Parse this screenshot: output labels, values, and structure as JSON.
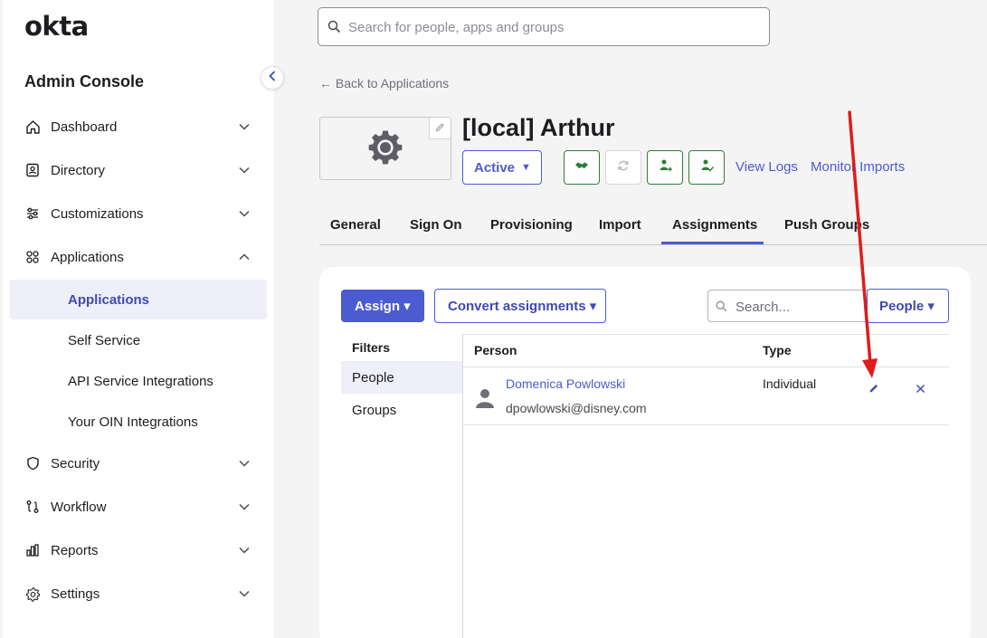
{
  "sidebar": {
    "logo": "okta",
    "title": "Admin Console",
    "items": [
      {
        "label": "Dashboard",
        "icon": "home-icon"
      },
      {
        "label": "Directory",
        "icon": "directory-icon"
      },
      {
        "label": "Customizations",
        "icon": "sliders-icon"
      },
      {
        "label": "Applications",
        "icon": "grid-icon"
      },
      {
        "label": "Security",
        "icon": "shield-icon"
      },
      {
        "label": "Workflow",
        "icon": "workflow-icon"
      },
      {
        "label": "Reports",
        "icon": "bar-chart-icon"
      },
      {
        "label": "Settings",
        "icon": "gear-icon"
      }
    ],
    "sub_items": [
      {
        "label": "Applications",
        "active": true
      },
      {
        "label": "Self Service"
      },
      {
        "label": "API Service Integrations"
      },
      {
        "label": "Your OIN Integrations"
      }
    ]
  },
  "search": {
    "placeholder": "Search for people, apps and groups"
  },
  "header": {
    "back_link": "← Back to Applications",
    "app_title": "[local] Arthur",
    "status": "Active",
    "view_logs": "View Logs",
    "monitor_imports": "Monitor Imports"
  },
  "tabs": [
    "General",
    "Sign On",
    "Provisioning",
    "Import",
    "Assignments",
    "Push Groups"
  ],
  "active_tab": "Assignments",
  "toolbar": {
    "assign": "Assign ▾",
    "convert": "Convert assignments ▾",
    "search_placeholder": "Search...",
    "people_dd": "People ▾"
  },
  "filters": {
    "label": "Filters",
    "items": [
      "People",
      "Groups"
    ]
  },
  "table": {
    "headers": [
      "Person",
      "Type"
    ],
    "rows": [
      {
        "name": "Domenica Powlowski",
        "email": "dpowlowski@disney.com",
        "type": "Individual"
      }
    ]
  },
  "colors": {
    "accent": "#4b5bd2",
    "green": "#2f7d3a",
    "annotation_arrow": "#e01b1b"
  }
}
